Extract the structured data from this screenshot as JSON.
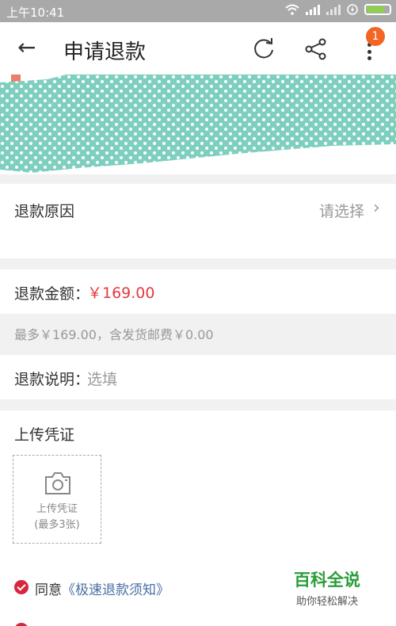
{
  "status": {
    "time": "上午10:41"
  },
  "appbar": {
    "title": "申请退款",
    "badge": "1"
  },
  "reason": {
    "label": "退款原因",
    "placeholder": "请选择"
  },
  "amount": {
    "label": "退款金额：",
    "value": "￥169.00"
  },
  "note": {
    "text": "最多￥169.00，含发货邮费￥0.00"
  },
  "explain": {
    "label": "退款说明：",
    "placeholder": "选填"
  },
  "upload": {
    "title": "上传凭证",
    "box_line1": "上传凭证",
    "box_line2": "(最多3张)"
  },
  "agreement": {
    "prefix": "同意",
    "link": "《极速退款须知》"
  },
  "watermark": {
    "title": "百科全说",
    "subtitle": "助你轻松解决"
  },
  "colors": {
    "accent": "#e4393c",
    "statusbar": "#a9a9a9",
    "check": "#d7263d",
    "badge": "#f26522",
    "pattern": "#7fcfbf"
  }
}
